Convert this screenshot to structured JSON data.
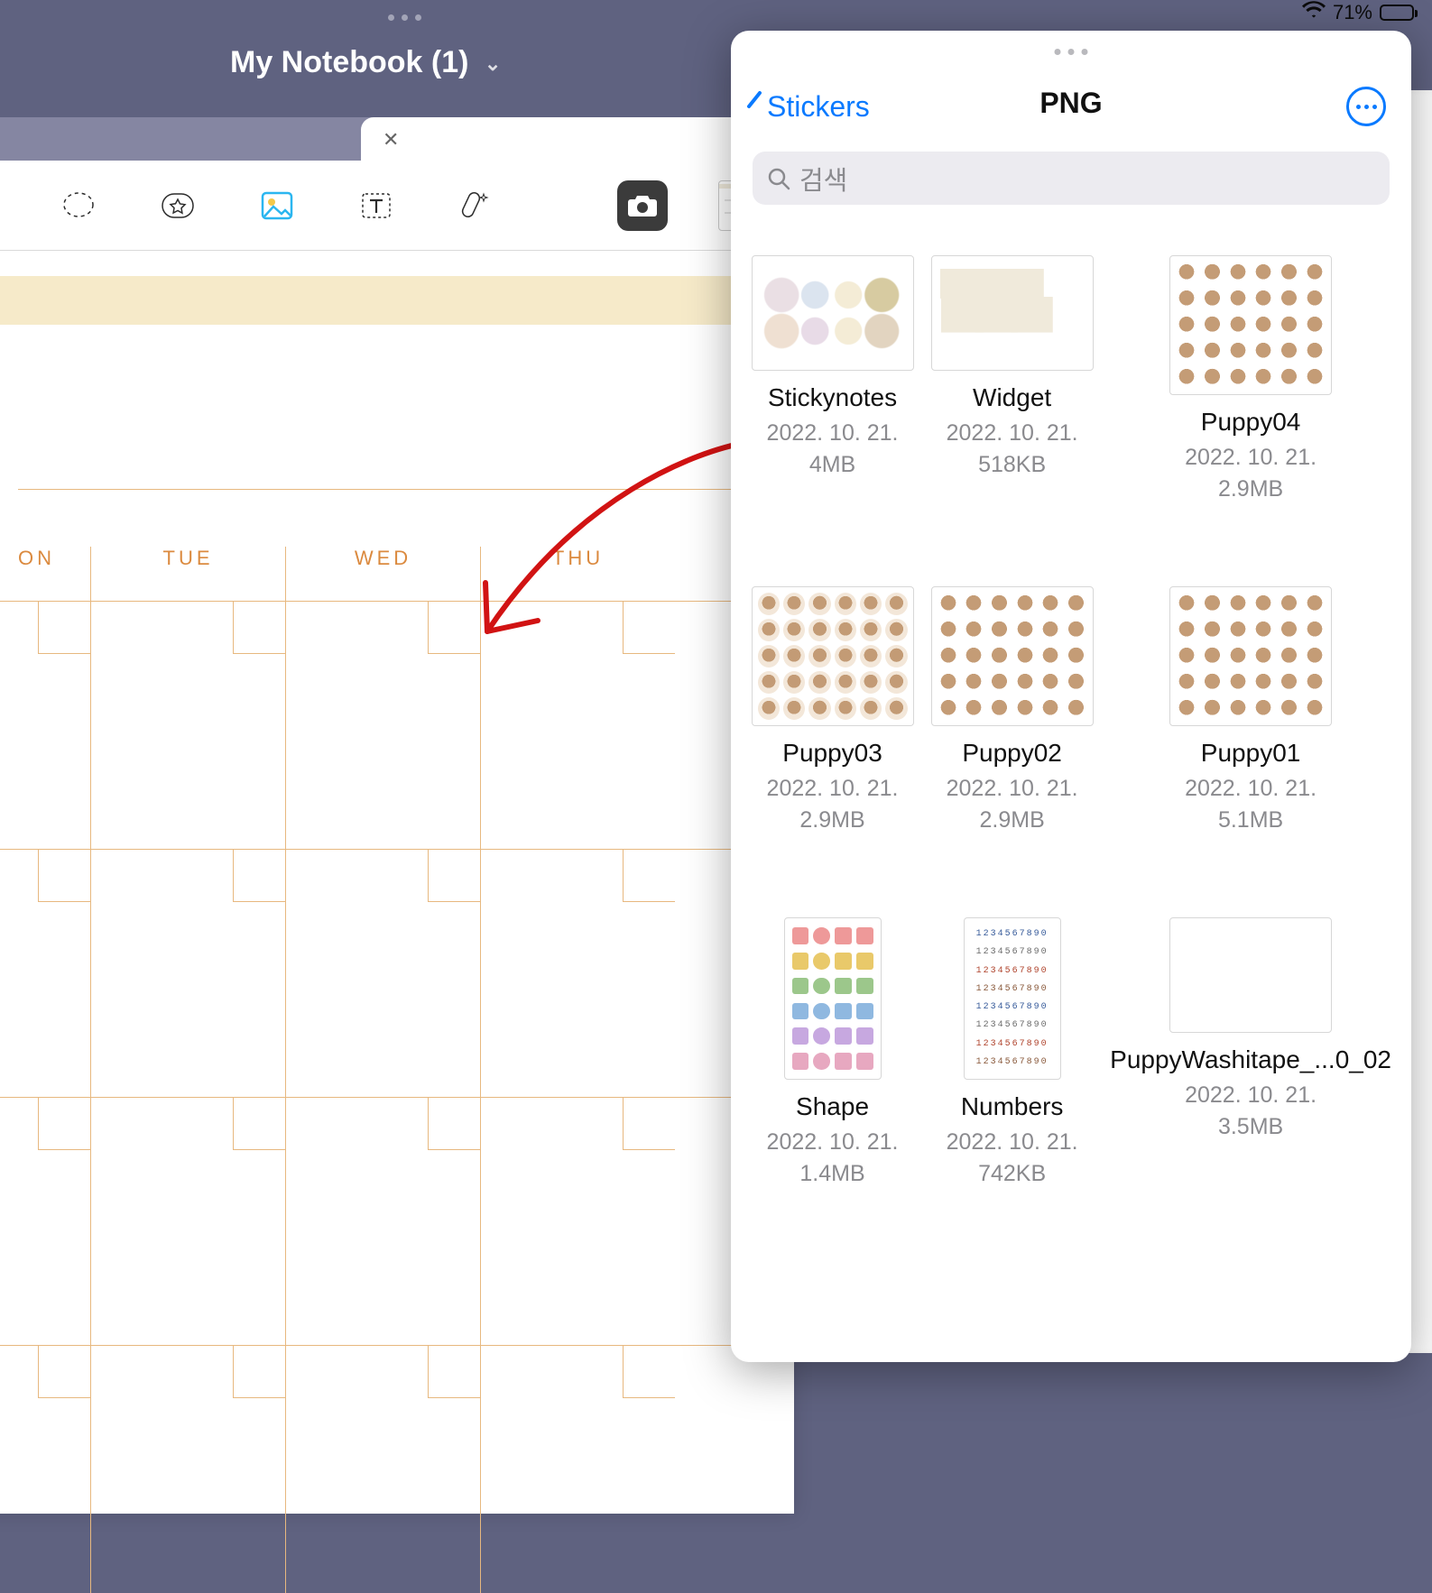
{
  "status_bar": {
    "battery_pct": "71%"
  },
  "app": {
    "notebook_title": "My Notebook (1)"
  },
  "calendar": {
    "headers": [
      "ON",
      "TUE",
      "WED",
      "THU"
    ]
  },
  "popover": {
    "back_label": "Stickers",
    "title": "PNG",
    "search_placeholder": "검색",
    "files": [
      {
        "name": "Stickynotes",
        "date": "2022. 10. 21.",
        "size": "4MB",
        "thumb": "stickynotes",
        "shape": "landscape"
      },
      {
        "name": "Widget",
        "date": "2022. 10. 21.",
        "size": "518KB",
        "thumb": "widget",
        "shape": "landscape"
      },
      {
        "name": "Puppy04",
        "date": "2022. 10. 21.",
        "size": "2.9MB",
        "thumb": "puppy",
        "shape": "square"
      },
      {
        "name": "Puppy03",
        "date": "2022. 10. 21.",
        "size": "2.9MB",
        "thumb": "puppy-bg",
        "shape": "square"
      },
      {
        "name": "Puppy02",
        "date": "2022. 10. 21.",
        "size": "2.9MB",
        "thumb": "puppy",
        "shape": "square"
      },
      {
        "name": "Puppy01",
        "date": "2022. 10. 21.",
        "size": "5.1MB",
        "thumb": "puppy",
        "shape": "square"
      },
      {
        "name": "Shape",
        "date": "2022. 10. 21.",
        "size": "1.4MB",
        "thumb": "shape",
        "shape": "portrait"
      },
      {
        "name": "Numbers",
        "date": "2022. 10. 21.",
        "size": "742KB",
        "thumb": "numbers",
        "shape": "portrait"
      },
      {
        "name": "PuppyWashitape_...0_02",
        "date": "2022. 10. 21.",
        "size": "3.5MB",
        "thumb": "washi",
        "shape": "landscape"
      }
    ]
  }
}
